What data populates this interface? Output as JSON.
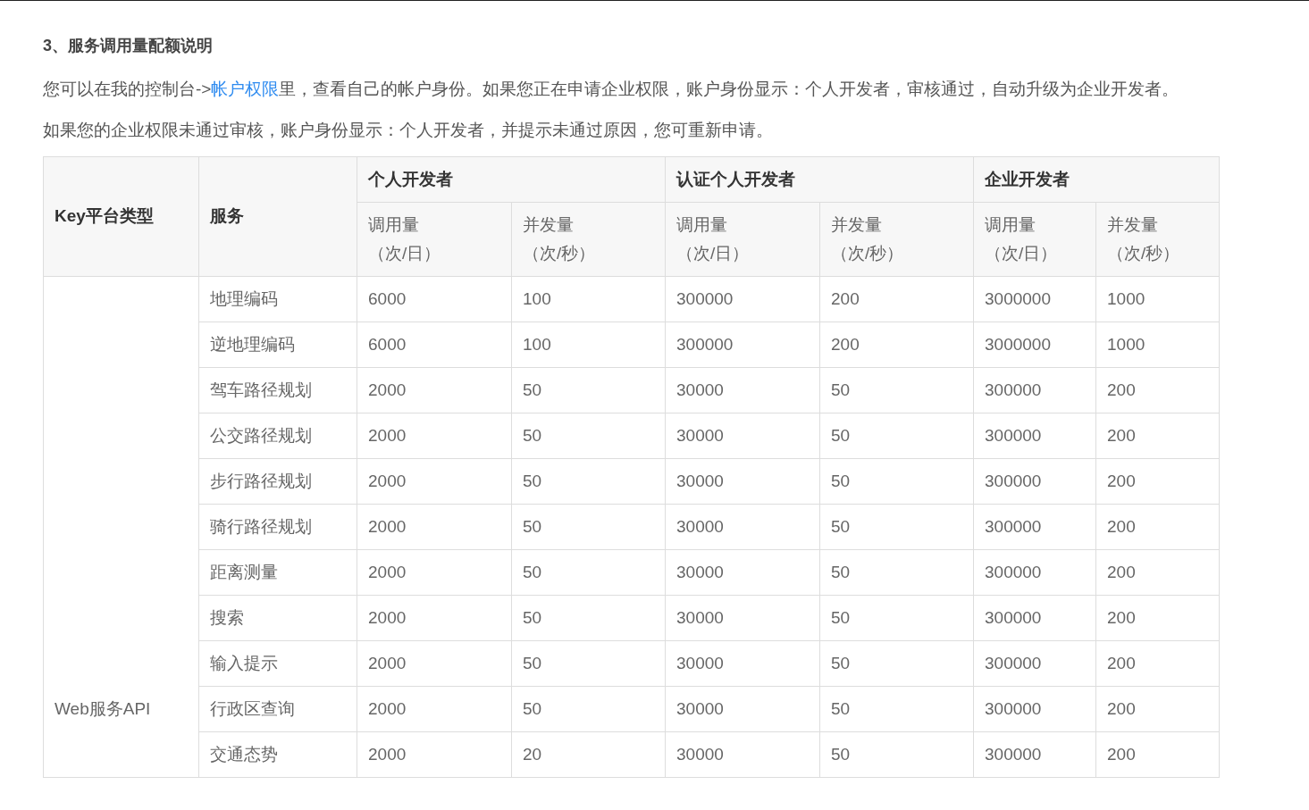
{
  "heading": "3、服务调用量配额说明",
  "intro": {
    "before": "您可以在我的控制台->",
    "link": "帐户权限",
    "after": "里，查看自己的帐户身份。如果您正在申请企业权限，账户身份显示：个人开发者，审核通过，自动升级为企业开发者。"
  },
  "note": "如果您的企业权限未通过审核，账户身份显示：个人开发者，并提示未通过原因，您可重新申请。",
  "table": {
    "col_platform": "Key平台类型",
    "col_service": "服务",
    "groups": [
      {
        "title": "个人开发者",
        "sub": [
          [
            "调用量",
            "（次/日）"
          ],
          [
            "并发量",
            "（次/秒）"
          ]
        ]
      },
      {
        "title": "认证个人开发者",
        "sub": [
          [
            "调用量",
            "（次/日）"
          ],
          [
            "并发量",
            "（次/秒）"
          ]
        ]
      },
      {
        "title": "企业开发者",
        "sub": [
          [
            "调用量",
            "（次/日）"
          ],
          [
            "并发量",
            "（次/秒）"
          ]
        ]
      }
    ],
    "platform": "Web服务API",
    "rows": [
      {
        "service": "地理编码",
        "values": [
          "6000",
          "100",
          "300000",
          "200",
          "3000000",
          "1000"
        ]
      },
      {
        "service": "逆地理编码",
        "values": [
          "6000",
          "100",
          "300000",
          "200",
          "3000000",
          "1000"
        ]
      },
      {
        "service": "驾车路径规划",
        "values": [
          "2000",
          "50",
          "30000",
          "50",
          "300000",
          "200"
        ]
      },
      {
        "service": "公交路径规划",
        "values": [
          "2000",
          "50",
          "30000",
          "50",
          "300000",
          "200"
        ]
      },
      {
        "service": "步行路径规划",
        "values": [
          "2000",
          "50",
          "30000",
          "50",
          "300000",
          "200"
        ]
      },
      {
        "service": "骑行路径规划",
        "values": [
          "2000",
          "50",
          "30000",
          "50",
          "300000",
          "200"
        ]
      },
      {
        "service": "距离测量",
        "values": [
          "2000",
          "50",
          "30000",
          "50",
          "300000",
          "200"
        ]
      },
      {
        "service": "搜索",
        "values": [
          "2000",
          "50",
          "30000",
          "50",
          "300000",
          "200"
        ]
      },
      {
        "service": "输入提示",
        "values": [
          "2000",
          "50",
          "30000",
          "50",
          "300000",
          "200"
        ]
      },
      {
        "service": "行政区查询",
        "values": [
          "2000",
          "50",
          "30000",
          "50",
          "300000",
          "200"
        ]
      },
      {
        "service": "交通态势",
        "values": [
          "2000",
          "20",
          "30000",
          "50",
          "300000",
          "200"
        ]
      }
    ]
  }
}
